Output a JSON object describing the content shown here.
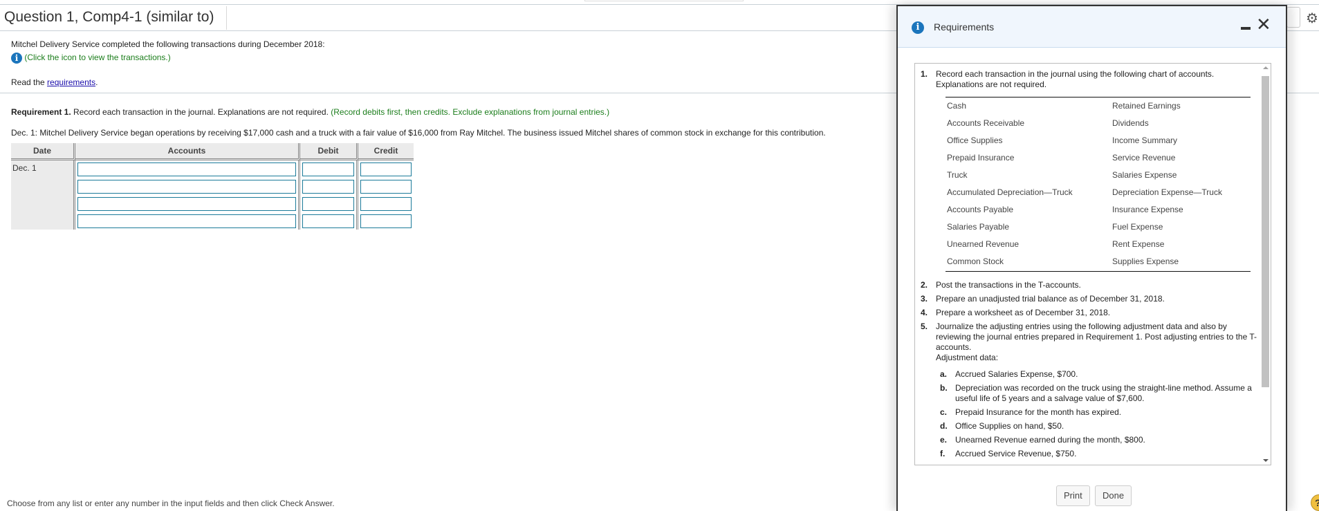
{
  "header": {
    "question_title": "Question 1, Comp4-1 (similar to)"
  },
  "intro": {
    "text": "Mitchel Delivery Service completed the following transactions during December 2018:",
    "click_icon_text": "(Click the icon to view the transactions.)",
    "read_prefix": "Read the ",
    "requirements_link": "requirements",
    "read_suffix": "."
  },
  "requirement": {
    "label": "Requirement 1.",
    "text": " Record each transaction in the journal. Explanations are not required. ",
    "instruction": "(Record debits first, then credits. Exclude explanations from journal entries.)",
    "transaction": "Dec. 1: Mitchel Delivery Service began operations by receiving $17,000 cash and a truck with a fair value of $16,000 from Ray Mitchel. The business issued Mitchel shares of common stock in exchange for this contribution."
  },
  "journal": {
    "headers": [
      "Date",
      "Accounts",
      "Debit",
      "Credit"
    ],
    "date": "Dec. 1",
    "rows": [
      {
        "account": "",
        "debit": "",
        "credit": ""
      },
      {
        "account": "",
        "debit": "",
        "credit": ""
      },
      {
        "account": "",
        "debit": "",
        "credit": ""
      },
      {
        "account": "",
        "debit": "",
        "credit": ""
      }
    ]
  },
  "footer": {
    "hint": "Choose from any list or enter any number in the input fields and then click Check Answer.",
    "help": "?"
  },
  "modal": {
    "title": "Requirements",
    "items": [
      {
        "num": "1.",
        "text": "Record each transaction in the journal using the following chart of accounts. Explanations are not required."
      },
      {
        "num": "2.",
        "text": "Post the transactions in the T-accounts."
      },
      {
        "num": "3.",
        "text": "Prepare an unadjusted trial balance as of December 31, 2018."
      },
      {
        "num": "4.",
        "text": "Prepare a worksheet as of December 31, 2018."
      },
      {
        "num": "5.",
        "text": "Journalize the adjusting entries using the following adjustment data and also by reviewing the journal entries prepared in Requirement 1. Post adjusting entries to the T-accounts."
      }
    ],
    "adjustment_label": "Adjustment data:",
    "chart_of_accounts": {
      "left": [
        "Cash",
        "Accounts Receivable",
        "Office Supplies",
        "Prepaid Insurance",
        "Truck",
        "Accumulated Depreciation—Truck",
        "Accounts Payable",
        "Salaries Payable",
        "Unearned Revenue",
        "Common Stock"
      ],
      "right": [
        "Retained Earnings",
        "Dividends",
        "Income Summary",
        "Service Revenue",
        "Salaries Expense",
        "Depreciation Expense—Truck",
        "Insurance Expense",
        "Fuel Expense",
        "Rent Expense",
        "Supplies Expense"
      ]
    },
    "adjustments": [
      {
        "letter": "a.",
        "text": "Accrued Salaries Expense, $700."
      },
      {
        "letter": "b.",
        "text": "Depreciation was recorded on the truck using the straight-line method. Assume a useful life of 5 years and a salvage value of $7,600."
      },
      {
        "letter": "c.",
        "text": "Prepaid Insurance for the month has expired."
      },
      {
        "letter": "d.",
        "text": "Office Supplies on hand, $50."
      },
      {
        "letter": "e.",
        "text": "Unearned Revenue earned during the month, $800."
      },
      {
        "letter": "f.",
        "text": "Accrued Service Revenue, $750."
      }
    ],
    "print_label": "Print",
    "done_label": "Done"
  },
  "colors": {
    "info_blue": "#1b75bc",
    "instruction_green": "#1b7d1b",
    "input_border": "#1a7a99",
    "modal_header_bg": "#f0f6fd"
  }
}
